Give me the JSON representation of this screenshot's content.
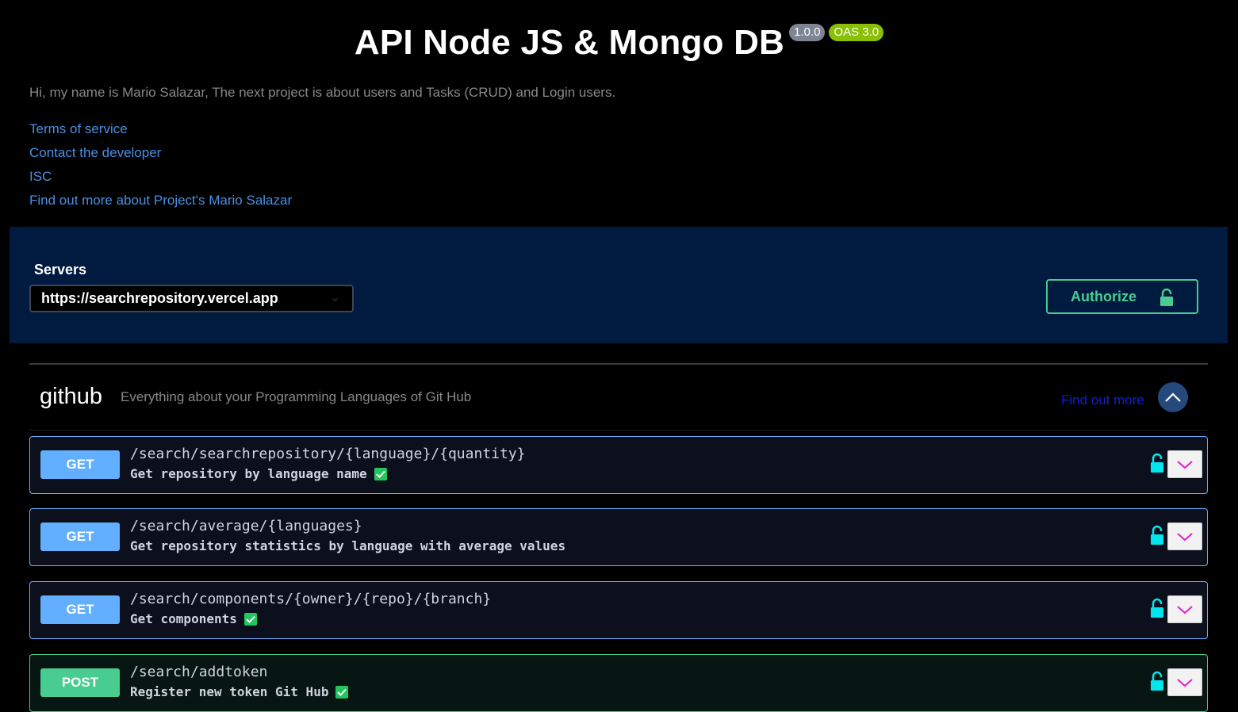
{
  "info": {
    "title": "API Node JS & Mongo DB",
    "version_badge": "1.0.0",
    "oas_badge": "OAS 3.0",
    "description": "Hi, my name is Mario Salazar, The next project is about users and Tasks (CRUD) and Login users.",
    "links": {
      "terms": "Terms of service",
      "contact": "Contact the developer",
      "license": "ISC",
      "external": "Find out more about Project's Mario Salazar"
    }
  },
  "servers": {
    "label": "Servers",
    "selected": "https://searchrepository.vercel.app"
  },
  "authorize": {
    "label": "Authorize"
  },
  "tag": {
    "name": "github",
    "description": "Everything about your Programming Languages of Git Hub",
    "find_more": "Find out more"
  },
  "operations": [
    {
      "method": "GET",
      "path": "/search/searchrepository/{language}/{quantity}",
      "summary": "Get repository by language name",
      "checked": true
    },
    {
      "method": "GET",
      "path": "/search/average/{languages}",
      "summary": "Get repository statistics by language with average values",
      "checked": false
    },
    {
      "method": "GET",
      "path": "/search/components/{owner}/{repo}/{branch}",
      "summary": "Get components",
      "checked": true
    },
    {
      "method": "POST",
      "path": "/search/addtoken",
      "summary": "Register new token Git Hub",
      "checked": true
    }
  ],
  "colors": {
    "get": "#61affe",
    "post": "#49cc90",
    "link": "#4990e2",
    "lock": "#00e5ee",
    "chevron": "#e11fd0"
  },
  "icons": {
    "authorize": "lock-icon",
    "collapse": "chevron-up-icon",
    "expand": "chevron-down-icon",
    "checked": "checkbox-checked-icon"
  }
}
